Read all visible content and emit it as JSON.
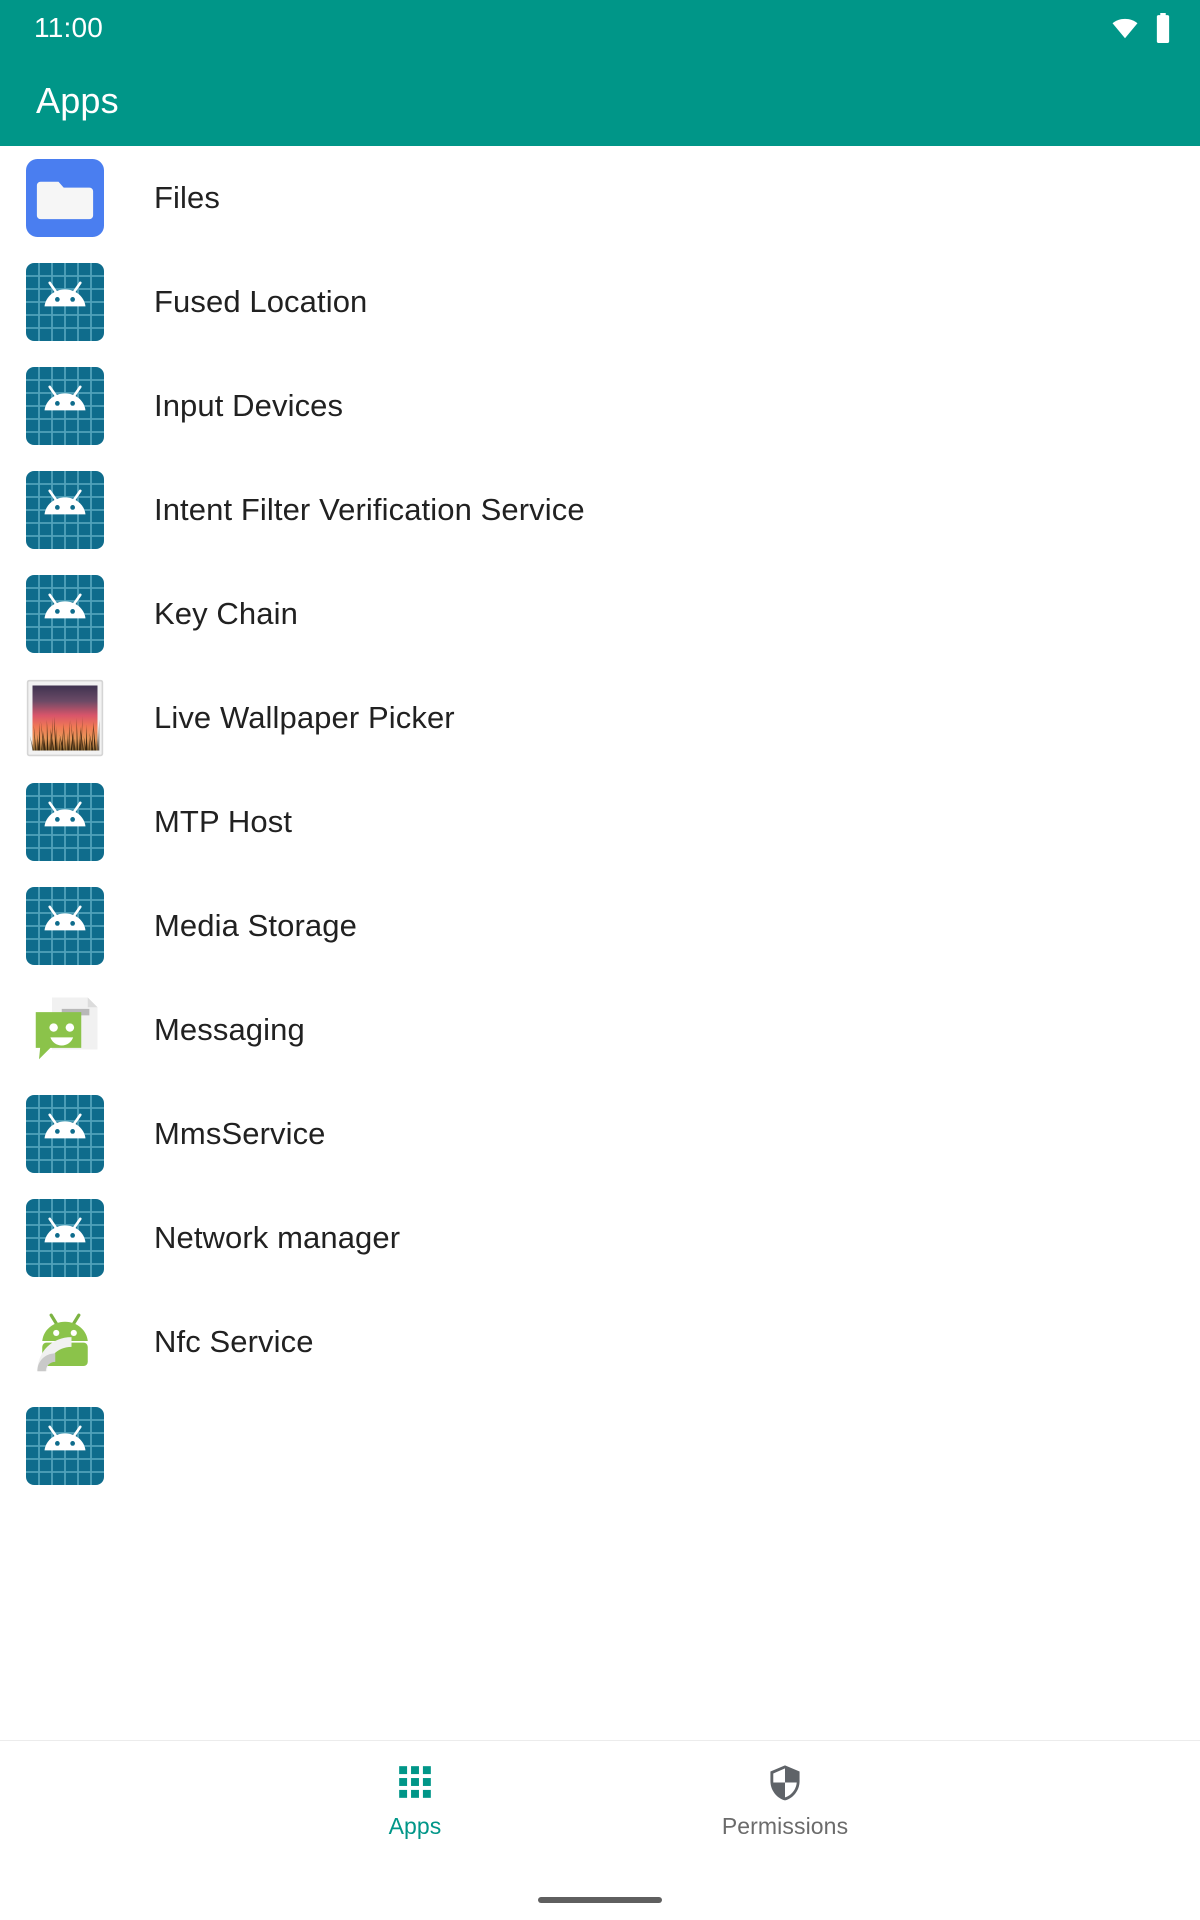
{
  "status_bar": {
    "clock": "11:00",
    "icons": [
      {
        "name": "wifi-icon",
        "glyph": "wifi"
      },
      {
        "name": "battery-icon",
        "glyph": "battery-full"
      }
    ]
  },
  "app_bar": {
    "title": "Apps",
    "background_color": "#009688",
    "text_color": "#ffffff"
  },
  "colors": {
    "accent": "#009688",
    "android_default_icon_bg": "#0f6c8c",
    "android_default_icon_grid": "#4f9cb5",
    "files_icon_bg": "#4a7ef0",
    "messaging_green": "#8bc34a",
    "bugdroid_green": "#8bc34a",
    "list_text": "#212121",
    "inactive_nav": "#6b6b6b"
  },
  "app_list": {
    "items": [
      {
        "label": "Files",
        "icon": "files-folder-icon"
      },
      {
        "label": "Fused Location",
        "icon": "android-default-icon"
      },
      {
        "label": "Input Devices",
        "icon": "android-default-icon"
      },
      {
        "label": "Intent Filter Verification Service",
        "icon": "android-default-icon"
      },
      {
        "label": "Key Chain",
        "icon": "android-default-icon"
      },
      {
        "label": "Live Wallpaper Picker",
        "icon": "wallpaper-photo-icon"
      },
      {
        "label": "MTP Host",
        "icon": "android-default-icon"
      },
      {
        "label": "Media Storage",
        "icon": "android-default-icon"
      },
      {
        "label": "Messaging",
        "icon": "messaging-bubble-icon"
      },
      {
        "label": "MmsService",
        "icon": "android-default-icon"
      },
      {
        "label": "Network manager",
        "icon": "android-default-icon"
      },
      {
        "label": "Nfc Service",
        "icon": "nfc-bugdroid-icon"
      },
      {
        "label": "",
        "icon": "android-default-icon"
      }
    ]
  },
  "bottom_nav": {
    "items": [
      {
        "label": "Apps",
        "icon": "apps-grid-icon",
        "active": true
      },
      {
        "label": "Permissions",
        "icon": "shield-icon",
        "active": false
      }
    ]
  }
}
